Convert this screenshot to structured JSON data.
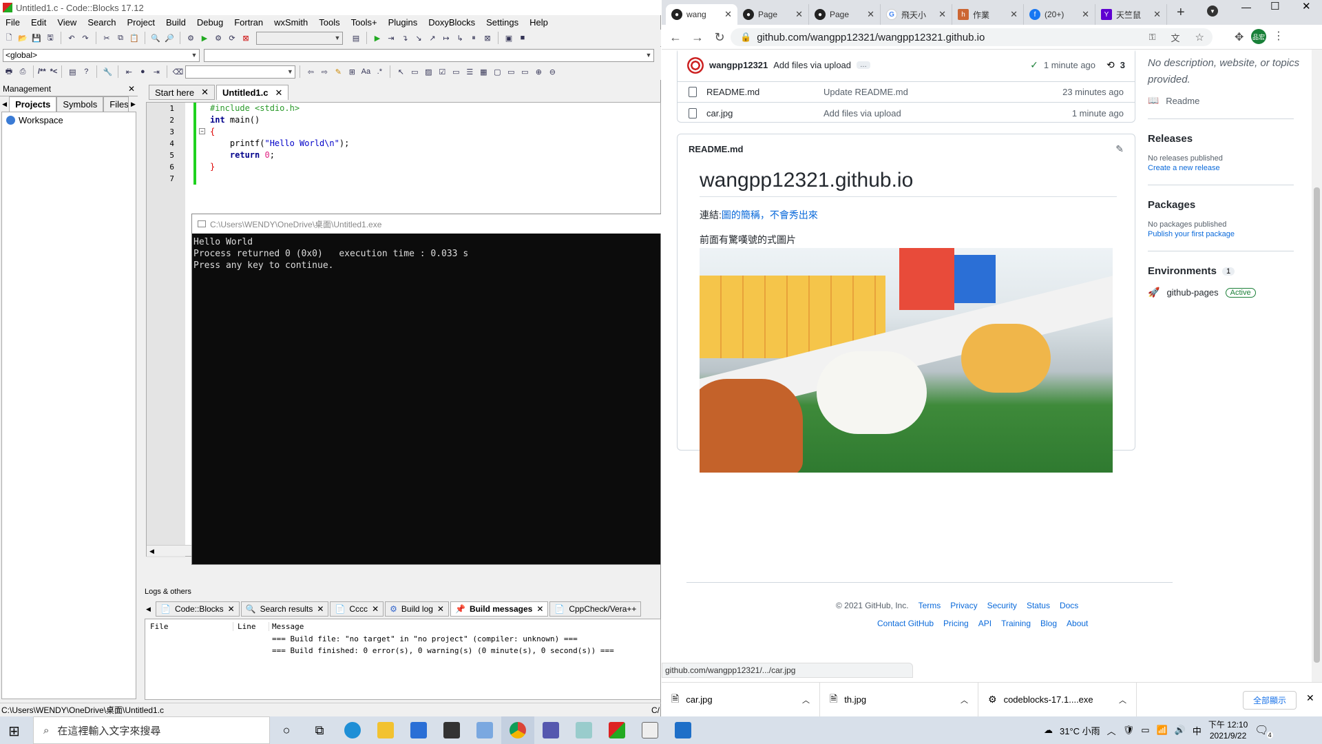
{
  "codeblocks": {
    "title": "Untitled1.c - Code::Blocks 17.12",
    "menu": [
      "File",
      "Edit",
      "View",
      "Search",
      "Project",
      "Build",
      "Debug",
      "Fortran",
      "wxSmith",
      "Tools",
      "Tools+",
      "Plugins",
      "DoxyBlocks",
      "Settings",
      "Help"
    ],
    "scope_combo": "<global>",
    "comment_btn": "/**",
    "comment_btn2": "*<",
    "management_title": "Management",
    "mgmt_tabs": [
      "Projects",
      "Symbols",
      "Files"
    ],
    "workspace": "Workspace",
    "editor_tabs": [
      "Start here",
      "Untitled1.c"
    ],
    "line_numbers": [
      "1",
      "2",
      "3",
      "4",
      "5",
      "6",
      "7"
    ],
    "code": {
      "l1": "#include <stdio.h>",
      "l2a": "int",
      "l2b": " main()",
      "l3": "{",
      "l4a": "    printf(",
      "l4b": "\"Hello World\\n\"",
      "l4c": ");",
      "l5a": "    return ",
      "l5b": "0",
      "l5c": ";",
      "l6": "}"
    },
    "console": {
      "title": "C:\\Users\\WENDY\\OneDrive\\桌面\\Untitled1.exe",
      "lines": [
        "Hello World",
        "",
        "Process returned 0 (0x0)   execution time : 0.033 s",
        "Press any key to continue."
      ]
    },
    "logs_header": "Logs & others",
    "logs_tabs": [
      "Code::Blocks",
      "Search results",
      "Cccc",
      "Build log",
      "Build messages",
      "CppCheck/Vera++"
    ],
    "log_columns": [
      "File",
      "Line",
      "Message"
    ],
    "log_rows": [
      "=== Build file: \"no target\" in \"no project\" (compiler: unknown) ===",
      "=== Build finished: 0 error(s), 0 warning(s) (0 minute(s), 0 second(s)) ==="
    ],
    "status": "C:\\Users\\WENDY\\OneDrive\\桌面\\Untitled1.c",
    "status_right": "C/"
  },
  "chrome": {
    "tabs": [
      {
        "label": "wang",
        "icon": "github-icon"
      },
      {
        "label": "Page",
        "icon": "github-icon"
      },
      {
        "label": "Page",
        "icon": "github-icon"
      },
      {
        "label": "飛天小",
        "icon": "google-icon"
      },
      {
        "label": "作業",
        "icon": "hahow-icon"
      },
      {
        "label": "(20+)",
        "icon": "facebook-icon"
      },
      {
        "label": "天竺鼠",
        "icon": "yahoo-icon"
      }
    ],
    "url": "github.com/wangpp12321/wangpp12321.github.io",
    "profile": "品宏",
    "commit": {
      "user": "wangpp12321",
      "message": "Add files via upload",
      "time": "1 minute ago",
      "count": "3"
    },
    "files": [
      {
        "name": "README.md",
        "msg": "Update README.md",
        "time": "23 minutes ago"
      },
      {
        "name": "car.jpg",
        "msg": "Add files via upload",
        "time": "1 minute ago"
      }
    ],
    "readme": {
      "label": "README.md",
      "heading": "wangpp12321.github.io",
      "link_prefix": "連結:",
      "link_text": "圖的簡稱，不會秀出來",
      "caption": "前面有驚嘆號的式圖片"
    },
    "sidebar": {
      "about": "No description, website, or topics provided.",
      "readme": "Readme",
      "releases": "Releases",
      "no_releases": "No releases published",
      "create_release": "Create a new release",
      "packages": "Packages",
      "no_packages": "No packages published",
      "publish_pkg": "Publish your first package",
      "environments": "Environments",
      "env_count": "1",
      "env_name": "github-pages",
      "env_status": "Active"
    },
    "footer": {
      "copyright": "© 2021 GitHub, Inc.",
      "row1": [
        "Terms",
        "Privacy",
        "Security",
        "Status",
        "Docs"
      ],
      "row2": [
        "Contact GitHub",
        "Pricing",
        "API",
        "Training",
        "Blog",
        "About"
      ]
    },
    "status_url": "github.com/wangpp12321/.../car.jpg",
    "downloads": [
      "car.jpg",
      "th.jpg",
      "codeblocks-17.1....exe"
    ],
    "show_all": "全部顯示"
  },
  "taskbar": {
    "search_placeholder": "在這裡輸入文字來搜尋",
    "weather": "31°C 小雨",
    "time": "下午 12:10",
    "date": "2021/9/22",
    "ime": "中",
    "notif": "4"
  }
}
